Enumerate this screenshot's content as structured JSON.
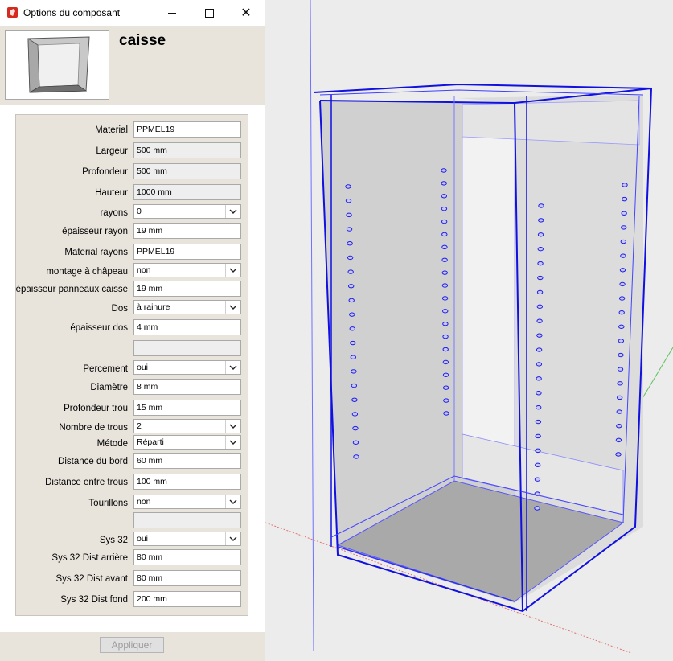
{
  "window": {
    "title": "Options du composant"
  },
  "component": {
    "name": "caisse"
  },
  "fields": [
    {
      "label": "Material",
      "value": "PPMEL19",
      "type": "text"
    },
    {
      "label": "Largeur",
      "value": "500 mm",
      "type": "readonly"
    },
    {
      "label": "Profondeur",
      "value": "500 mm",
      "type": "readonly"
    },
    {
      "label": "Hauteur",
      "value": "1000 mm",
      "type": "readonly"
    },
    {
      "label": "rayons",
      "value": "0",
      "type": "select"
    },
    {
      "label": "épaisseur rayon",
      "value": "19 mm",
      "type": "text"
    },
    {
      "label": "Material rayons",
      "value": "PPMEL19",
      "type": "text"
    },
    {
      "label": "montage à châpeau",
      "value": "non",
      "type": "select"
    },
    {
      "label": "épaisseur panneaux caisse",
      "value": "19 mm",
      "type": "text"
    },
    {
      "label": "Dos",
      "value": "à rainure",
      "type": "select"
    },
    {
      "label": "épaisseur dos",
      "value": "4 mm",
      "type": "text"
    },
    {
      "label": "",
      "value": "",
      "type": "separator"
    },
    {
      "label": "Percement",
      "value": "oui",
      "type": "select"
    },
    {
      "label": "Diamètre",
      "value": "8 mm",
      "type": "text"
    },
    {
      "label": "Profondeur trou",
      "value": "15 mm",
      "type": "text"
    },
    {
      "label": "Nombre de trous",
      "value": "2",
      "type": "select"
    },
    {
      "label": "Métode",
      "value": "Réparti",
      "type": "select"
    },
    {
      "label": "Distance du bord",
      "value": "60 mm",
      "type": "text"
    },
    {
      "label": "Distance entre trous",
      "value": "100 mm",
      "type": "text"
    },
    {
      "label": "Tourillons",
      "value": "non",
      "type": "select"
    },
    {
      "label": "",
      "value": "",
      "type": "separator"
    },
    {
      "label": "Sys 32",
      "value": "oui",
      "type": "select"
    },
    {
      "label": "Sys 32 Dist arrière",
      "value": "80 mm",
      "type": "text"
    },
    {
      "label": "Sys 32 Dist avant",
      "value": "80 mm",
      "type": "text"
    },
    {
      "label": "Sys 32 Dist fond",
      "value": "200 mm",
      "type": "text"
    }
  ],
  "buttons": {
    "apply": "Appliquer"
  },
  "icons": {
    "app": "sketchup-icon",
    "minimize": "minimize-icon",
    "maximize": "maximize-icon",
    "close": "close-icon"
  },
  "colors": {
    "selection": "#0000e0",
    "panel_bg": "#e8e4dc",
    "viewport_bg": "#ececec"
  }
}
